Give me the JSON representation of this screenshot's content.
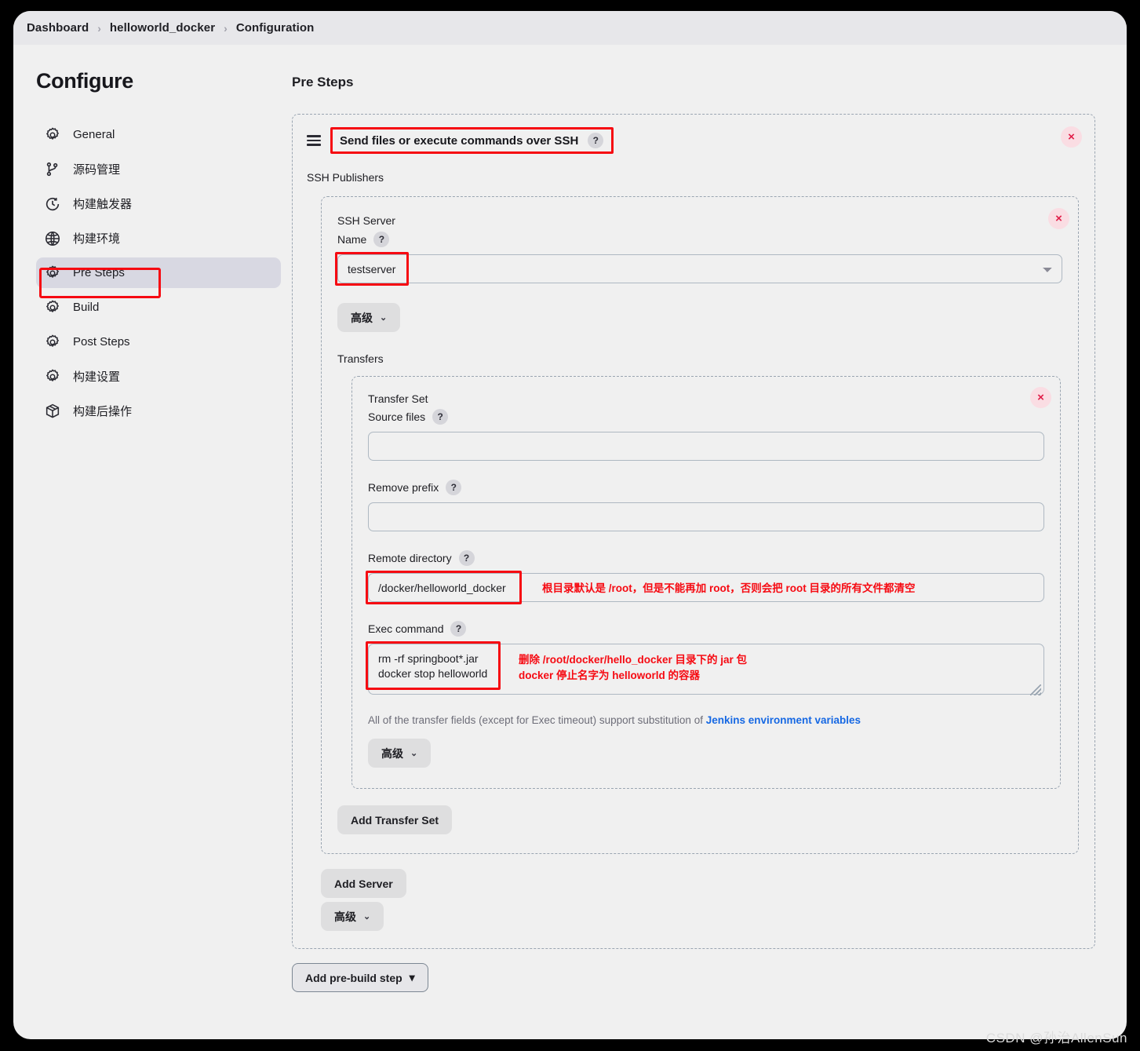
{
  "breadcrumb": {
    "items": [
      {
        "label": "Dashboard"
      },
      {
        "label": "helloworld_docker"
      },
      {
        "label": "Configuration"
      }
    ],
    "separator": "›"
  },
  "sidebar": {
    "title": "Configure",
    "items": [
      {
        "label": "General",
        "icon": "gear-icon",
        "active": false
      },
      {
        "label": "源码管理",
        "icon": "git-branch-icon",
        "active": false
      },
      {
        "label": "构建触发器",
        "icon": "clock-icon",
        "active": false
      },
      {
        "label": "构建环境",
        "icon": "globe-icon",
        "active": false
      },
      {
        "label": "Pre Steps",
        "icon": "gear-icon",
        "active": true
      },
      {
        "label": "Build",
        "icon": "gear-icon",
        "active": false
      },
      {
        "label": "Post Steps",
        "icon": "gear-icon",
        "active": false
      },
      {
        "label": "构建设置",
        "icon": "gear-icon",
        "active": false
      },
      {
        "label": "构建后操作",
        "icon": "package-icon",
        "active": false
      }
    ]
  },
  "main": {
    "heading": "Pre Steps",
    "builder": {
      "title": "Send files or execute commands over SSH",
      "help": "?",
      "drag_handle": "drag-handle-icon",
      "delete": "×",
      "publishers_label": "SSH Publishers",
      "server": {
        "title": "SSH Server",
        "name_label": "Name",
        "help": "?",
        "selected": "testserver",
        "delete": "×",
        "advanced_label": "高级",
        "chevron": "⌄",
        "transfers_label": "Transfers",
        "transfer_set": {
          "title": "Transfer Set",
          "delete": "×",
          "fields": [
            {
              "label": "Source files",
              "help": "?",
              "value": ""
            },
            {
              "label": "Remove prefix",
              "help": "?",
              "value": ""
            },
            {
              "label": "Remote directory",
              "help": "?",
              "value": "/docker/helloworld_docker"
            }
          ],
          "exec": {
            "label": "Exec command",
            "help": "?",
            "value": "rm -rf springboot*.jar\ndocker stop helloworld"
          },
          "hint_prefix": "All of the transfer fields (except for Exec timeout) support substitution of ",
          "hint_link": "Jenkins environment variables",
          "advanced_label": "高级",
          "chevron": "⌄"
        },
        "add_transfer_set_label": "Add Transfer Set"
      },
      "add_server_label": "Add Server",
      "advanced_label": "高级",
      "chevron": "⌄"
    },
    "add_pre_build_step_label": "Add pre-build step",
    "add_pre_build_step_caret": "▾"
  },
  "annotations": {
    "remote_directory_note": "根目录默认是 /root，但是不能再加 root，否则会把 root 目录的所有文件都清空",
    "exec_command_note": "删除 /root/docker/hello_docker 目录下的 jar 包\ndocker 停止名字为 helloworld 的容器"
  },
  "watermark": "CSDN @孙治AllenSun",
  "colors": {
    "annotation_red": "#f60a12",
    "link_blue": "#1668e3",
    "active_nav": "#d8d8e2",
    "delete_red": "#e11d48"
  }
}
